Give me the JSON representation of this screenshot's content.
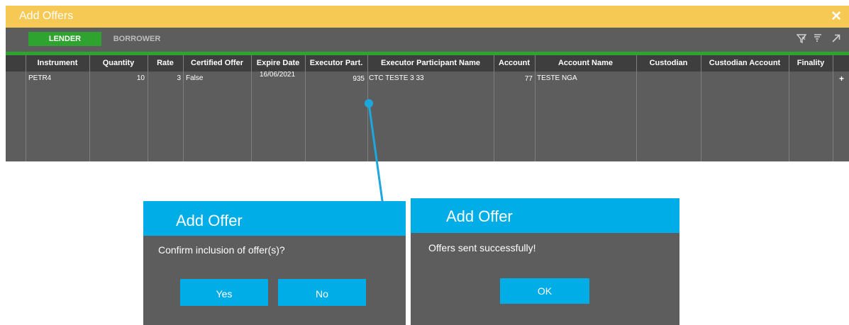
{
  "window": {
    "title": "Add Offers",
    "close_icon": "close-icon",
    "titlebar_color": "#f6c955"
  },
  "tabs": [
    {
      "label": "LENDER",
      "active": true
    },
    {
      "label": "BORROWER",
      "active": false
    }
  ],
  "toolbar_icons": [
    "clear-filter-icon",
    "filter-icon",
    "expand-icon"
  ],
  "grid": {
    "columns": [
      "Instrument",
      "Quantity",
      "Rate",
      "Certified Offer",
      "Expire Date",
      "Executor Part.",
      "Executor Participant Name",
      "Account",
      "Account Name",
      "Custodian",
      "Custodian Account",
      "Finality"
    ],
    "rows": [
      {
        "instrument": "PETR4",
        "quantity": "10",
        "rate": "3",
        "certified_offer": "False",
        "expire_date": "16/06/2021",
        "executor_part": "935",
        "executor_participant_name": "CTC TESTE 3 33",
        "account": "77",
        "account_name": "TESTE NGA",
        "custodian": "",
        "custodian_account": "",
        "finality": "",
        "action": "+"
      }
    ]
  },
  "dialog_confirm": {
    "title": "Add Offer",
    "message": "Confirm inclusion of offer(s)?",
    "yes_label": "Yes",
    "no_label": "No"
  },
  "dialog_success": {
    "title": "Add Offer",
    "message": "Offers sent successfully!",
    "ok_label": "OK"
  },
  "colors": {
    "accent": "#00ade7",
    "active_tab": "#2fa32f",
    "panel": "#5d5d5d",
    "header": "#3e3e3e"
  }
}
